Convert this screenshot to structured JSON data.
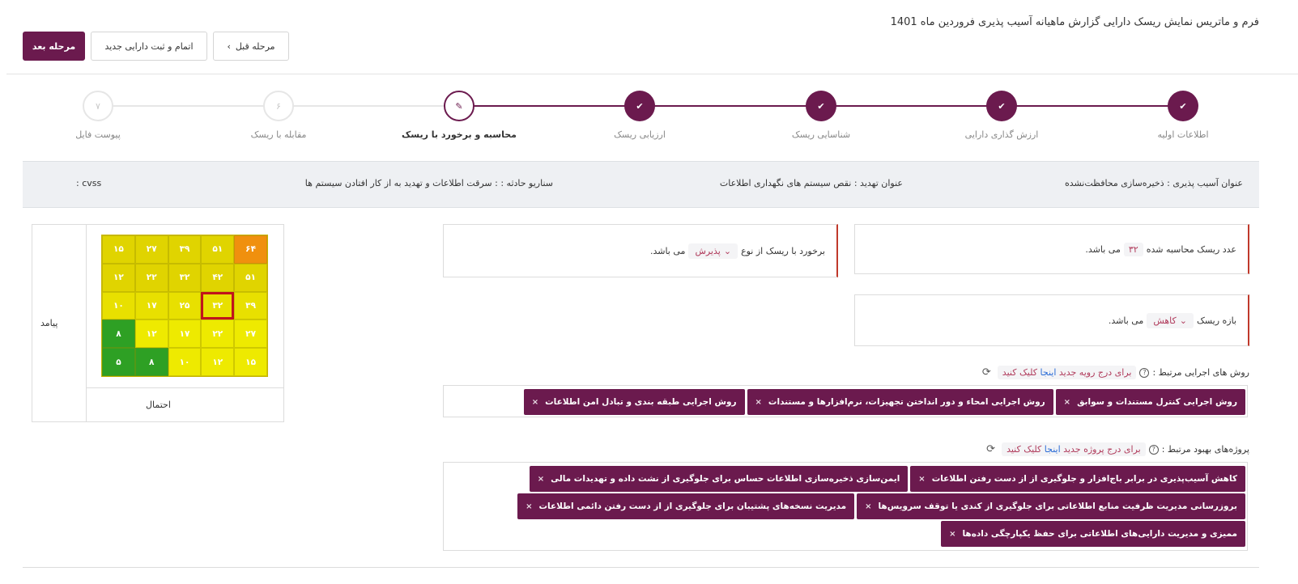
{
  "header": {
    "title": "فرم و ماتریس نمایش ریسک دارایی گزارش ماهیانه آسیب پذیری فروردین ماه 1401",
    "buttons": {
      "next": "مرحله بعد",
      "finish_new": "اتمام و ثبت دارایی جدید",
      "prev": "مرحله قبل"
    }
  },
  "stepper": {
    "steps": [
      {
        "label": "اطلاعات اولیه",
        "state": "done",
        "icon": "check-icon"
      },
      {
        "label": "ارزش گذاری دارایی",
        "state": "done",
        "icon": "check-icon"
      },
      {
        "label": "شناسایی ریسک",
        "state": "done",
        "icon": "check-icon"
      },
      {
        "label": "ارزیابی ریسک",
        "state": "done",
        "icon": "check-icon"
      },
      {
        "label": "محاسبه و برخورد با ریسک",
        "state": "current",
        "icon": "pencil-icon"
      },
      {
        "label": "مقابله با ریسک",
        "state": "todo",
        "number": "۶"
      },
      {
        "label": "پیوست فایل",
        "state": "todo",
        "number": "۷"
      }
    ]
  },
  "info": {
    "vulnerability": "عنوان آسیب پذیری : ذخیره‌سازی محافظت‌نشده",
    "threat": "عنوان تهدید : نقص سیستم های نگهداری اطلاعات",
    "scenario": "سناریو حادثه : :  سرقت اطلاعات و تهدید به از کار افتادن سیستم ها",
    "cvss": "cvss :"
  },
  "risk_number": {
    "prefix": "عدد ریسک محاسبه شده",
    "value": "۳۲",
    "suffix": "می باشد."
  },
  "risk_range": {
    "prefix": "بازه ریسک",
    "value": "کاهش",
    "suffix": "می باشد."
  },
  "risk_treatment": {
    "prefix": "برخورد با ریسک از نوع",
    "value": "پذیرش",
    "suffix": "می باشد."
  },
  "procedures": {
    "label": "روش های اجرایی مرتبط :",
    "hint_prefix": "برای درج رویه جدید",
    "hint_link": "اینجا",
    "hint_suffix": "کلیک کنید",
    "tags": [
      "روش اجرایی کنترل مستندات و سوابق",
      "روش اجرایی امحاء و دور انداختن تجهیزات، نرم‌افزارها و مستندات",
      "روش اجرایی طبقه بندی و تبادل امن اطلاعات"
    ]
  },
  "projects": {
    "label": "پروژه‌های بهبود مرتبط :",
    "hint_prefix": "برای درج پروژه جدید",
    "hint_link": "اینجا",
    "hint_suffix": "کلیک کنید",
    "rows": [
      [
        "کاهش آسیب‌پذیری در برابر باج‌افزار و جلوگیری از از دست رفتن اطلاعات",
        "ایمن‌سازی ذخیره‌سازی اطلاعات حساس برای جلوگیری از نشت داده و تهدیدات مالی"
      ],
      [
        "بروزرسانی مدیریت ظرفیت منابع اطلاعاتی برای جلوگیری از کندی یا توقف سرویس‌ها",
        "مدیریت نسخه‌های پشتیبان برای جلوگیری از از دست رفتن دائمی اطلاعات"
      ],
      [
        "ممیزی و مدیریت دارایی‌های اطلاعاتی برای حفظ یکپارچگی داده‌ها"
      ]
    ],
    "remove_symbol": "×"
  },
  "matrix": {
    "y_label": "پیامد",
    "x_label": "احتمال",
    "rows": [
      [
        "۱۵",
        "۲۷",
        "۳۹",
        "۵۱",
        "۶۴"
      ],
      [
        "۱۲",
        "۲۲",
        "۳۲",
        "۴۲",
        "۵۱"
      ],
      [
        "۱۰",
        "۱۷",
        "۲۵",
        "۳۲",
        "۳۹"
      ],
      [
        "۸",
        "۱۲",
        "۱۷",
        "۲۲",
        "۲۷"
      ],
      [
        "۵",
        "۸",
        "۱۰",
        "۱۲",
        "۱۵"
      ]
    ],
    "colors": [
      [
        "#e0d400",
        "#e0d400",
        "#e0d400",
        "#e0d400",
        "#f0900e"
      ],
      [
        "#e0d400",
        "#e0d400",
        "#e0d400",
        "#e0d400",
        "#e0d400"
      ],
      [
        "#e8e000",
        "#e8e000",
        "#e8e000",
        "#e8e000",
        "#e8e000"
      ],
      [
        "#2ea024",
        "#eeea00",
        "#eeea00",
        "#eeea00",
        "#eeea00"
      ],
      [
        "#2ea024",
        "#2ea024",
        "#eeea00",
        "#eeea00",
        "#eeea00"
      ]
    ],
    "selected": {
      "row": 2,
      "col": 3
    }
  },
  "colors": {
    "brand": "#6b1a4e",
    "accent_red": "#c0392b",
    "selected_border": "#c0141c"
  }
}
